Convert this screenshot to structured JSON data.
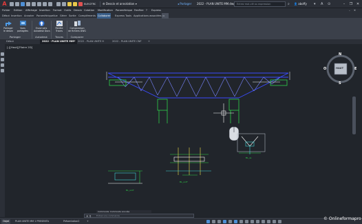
{
  "titlebar": {
    "app_letter": "A",
    "workspace": "Dessin et annotation",
    "share": "Partager",
    "document_title": "2022 - PLAN UNITE MM.dwg",
    "search_placeholder": "Entrez mot-clé ou expression",
    "user": "aboffy",
    "qa_label": "ELEV2TRC"
  },
  "menubar": {
    "items": [
      "Fichier",
      "Edition",
      "Affichage",
      "Insertion",
      "Format",
      "Outils",
      "Dessin",
      "Cotation",
      "Modification",
      "Paramétrique",
      "Fenêtre",
      "?",
      "Express"
    ]
  },
  "ribbon_tabs": {
    "items": [
      "Début",
      "Insertion",
      "Annoter",
      "Paramétrique",
      "Vue",
      "Gérer",
      "Sortie",
      "Compléments",
      "Collaborer",
      "Express Tools",
      "Applications associées"
    ],
    "active_index": 8
  },
  "ribbon": {
    "buttons": [
      {
        "label1": "Partager",
        "label2": "le dessin"
      },
      {
        "label1": "Vues",
        "label2": "partagées"
      },
      {
        "label1": "Envoi vers",
        "label2": "Autodesk Docs"
      },
      {
        "label1": "Palette",
        "label2": "Traces"
      },
      {
        "label1": "Comparaison",
        "label2": "de fichiers DWG"
      }
    ],
    "groups": [
      "Partager",
      "Autodesk Docs",
      "Traces",
      "Comparer"
    ]
  },
  "doc_tabs": {
    "items": [
      "Début",
      "2022 - PLAN UNITE MM*",
      "2022 - PLAN UNITE H",
      "2022 - PLAN UNITE CNF",
      "+"
    ]
  },
  "viewport": {
    "label": "[-][Haut][Filaire 2D]",
    "viewcube": {
      "top": "HAUT",
      "n": "N",
      "s": "S",
      "e": "E",
      "o": "O"
    }
  },
  "drawing_texts": {
    "label_a": "BL_uniT",
    "label_b": "BL_uniF",
    "label_c": "BL_ss"
  },
  "commandline": {
    "history": "Commande: Commande annulée",
    "prompt": "Entrez une commande"
  },
  "statusbar": {
    "tabs": [
      "Objet",
      "PLAN UNITE MM 1 PRESENTA",
      "Présentation2",
      "+"
    ],
    "active_index": 0
  },
  "watermark": "© Onlineformapro",
  "colors": {
    "ribbon_active": "#3a5f8a",
    "drawing_blue": "#3a4cff",
    "drawing_green": "#2fd14a",
    "drawing_white": "#ffffff",
    "drawing_yellow": "#f2e34c",
    "drawing_cyan": "#3fd7d7"
  }
}
